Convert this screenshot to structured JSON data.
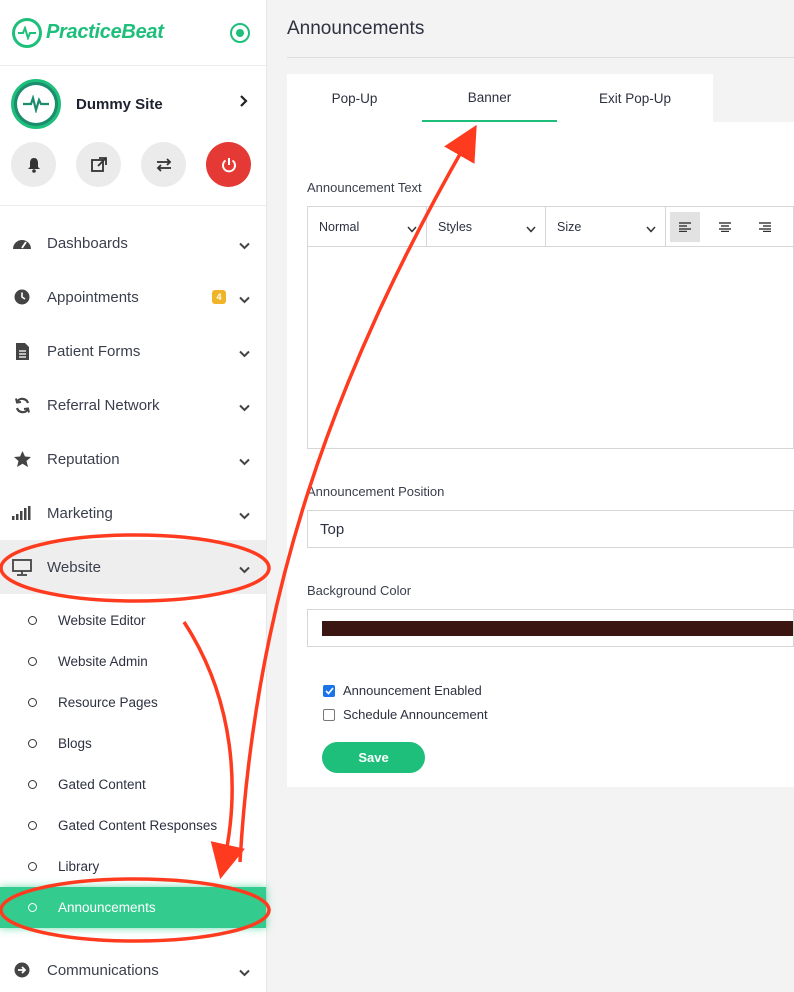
{
  "brand": {
    "name": "PracticeBeat"
  },
  "site": {
    "name": "Dummy Site"
  },
  "nav": {
    "items": [
      {
        "label": "Dashboards"
      },
      {
        "label": "Appointments",
        "badge": "4"
      },
      {
        "label": "Patient Forms"
      },
      {
        "label": "Referral Network"
      },
      {
        "label": "Reputation"
      },
      {
        "label": "Marketing"
      },
      {
        "label": "Website"
      }
    ],
    "website_sub": [
      {
        "label": "Website Editor"
      },
      {
        "label": "Website Admin"
      },
      {
        "label": "Resource Pages"
      },
      {
        "label": "Blogs"
      },
      {
        "label": "Gated Content"
      },
      {
        "label": "Gated Content Responses"
      },
      {
        "label": "Library"
      },
      {
        "label": "Announcements"
      }
    ],
    "communications": {
      "label": "Communications"
    }
  },
  "main": {
    "title": "Announcements",
    "tabs": [
      {
        "label": "Pop-Up"
      },
      {
        "label": "Banner"
      },
      {
        "label": "Exit Pop-Up"
      }
    ],
    "text_label": "Announcement Text",
    "toolbar": {
      "format": "Normal",
      "styles": "Styles",
      "size": "Size"
    },
    "position_label": "Announcement Position",
    "position_value": "Top",
    "bg_label": "Background Color",
    "bg_color": "#3a1512",
    "enabled_label": "Announcement Enabled",
    "schedule_label": "Schedule Announcement",
    "save_label": "Save"
  },
  "colors": {
    "accent": "#1dbf7b",
    "power": "#e53935",
    "annotation": "#ff3b1f",
    "badge": "#f0b429"
  }
}
